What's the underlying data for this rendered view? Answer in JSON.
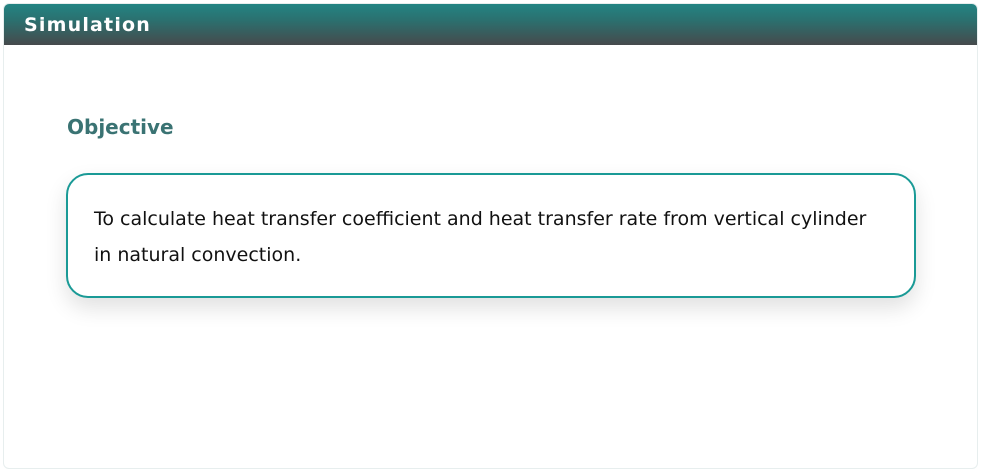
{
  "header": {
    "title": "Simulation"
  },
  "objective": {
    "heading": "Objective",
    "text": "To calculate heat transfer coefficient and heat transfer rate from vertical cylinder in natural convection."
  },
  "colors": {
    "header_gradient_top": "#238483",
    "header_gradient_bottom": "#464a4c",
    "heading_color": "#3a7373",
    "box_border": "#1a9a96"
  }
}
